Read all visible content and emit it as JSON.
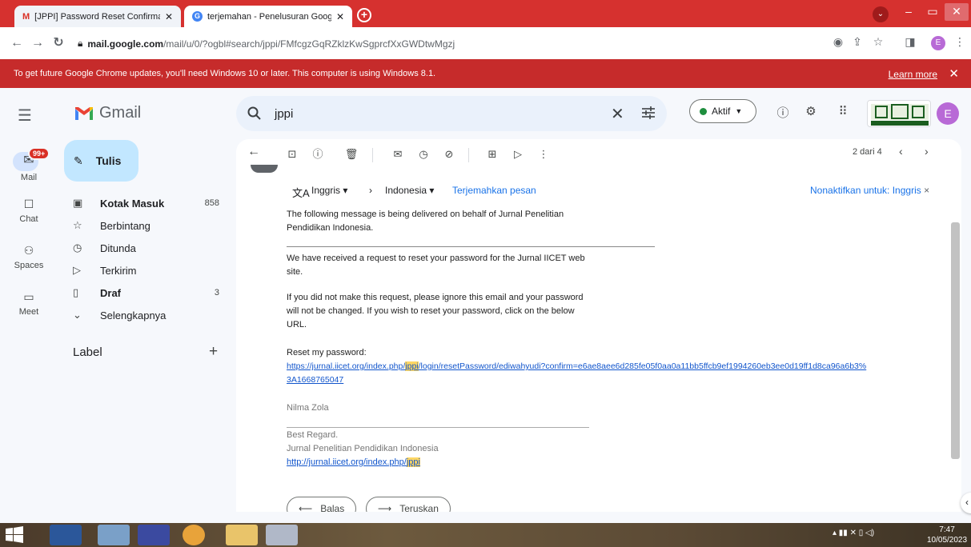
{
  "browser": {
    "tabs": [
      {
        "title": "[JPPI] Password Reset Confirmatio",
        "active": false
      },
      {
        "title": "terjemahan - Penelusuran Google",
        "active": true
      }
    ],
    "url_host": "mail.google.com",
    "url_path": "/mail/u/0/?ogbl#search/jppi/FMfcgzGqRZklzKwSgprcfXxGWDtwMgzj",
    "profile_initial": "E",
    "update_warning": "To get future Google Chrome updates, you'll need Windows 10 or later. This computer is using Windows 8.1.",
    "learn_more": "Learn more"
  },
  "gmail": {
    "app_name": "Gmail",
    "search_query": "jppi",
    "status": "Aktif",
    "avatar_initial": "E",
    "rail": [
      {
        "label": "Mail",
        "icon": "mail-icon",
        "badge": "99+"
      },
      {
        "label": "Chat",
        "icon": "chat-icon"
      },
      {
        "label": "Spaces",
        "icon": "spaces-icon"
      },
      {
        "label": "Meet",
        "icon": "meet-icon"
      }
    ],
    "compose_label": "Tulis",
    "nav": [
      {
        "label": "Kotak Masuk",
        "count": "858",
        "icon": "inbox-icon",
        "bold": true
      },
      {
        "label": "Berbintang",
        "count": "",
        "icon": "star-icon",
        "bold": false
      },
      {
        "label": "Ditunda",
        "count": "",
        "icon": "clock-icon",
        "bold": false
      },
      {
        "label": "Terkirim",
        "count": "",
        "icon": "send-icon",
        "bold": false
      },
      {
        "label": "Draf",
        "count": "3",
        "icon": "draft-icon",
        "bold": true
      },
      {
        "label": "Selengkapnya",
        "count": "",
        "icon": "chevron-down-icon",
        "bold": false
      }
    ],
    "labels_heading": "Label",
    "pager_text": "2 dari 4"
  },
  "translate": {
    "source_lang": "Inggris",
    "target_lang": "Indonesia",
    "translate_link": "Terjemahkan pesan",
    "disable_link": "Nonaktifkan untuk: Inggris"
  },
  "message": {
    "intro": "The following message is being delivered on behalf of Jurnal Penelitian Pendidikan Indonesia.",
    "intro_l1": "The following message is being delivered on behalf of Jurnal Penelitian",
    "intro_l2": "Pendidikan Indonesia.",
    "p1_l1": "We have received a request to reset your password for the Jurnal IICET web",
    "p1_l2": "site.",
    "p2_l1": "If you did not make this request, please ignore this email and your password",
    "p2_l2": "will not be changed. If you wish to reset your password, click on the below",
    "p2_l3": "URL.",
    "reset_label": "Reset my password:",
    "reset_url_a": "https://jurnal.iicet.org/index.php/",
    "reset_url_hl": "jppi",
    "reset_url_b": "/login/resetPassword/ediwahyudi?confirm=e6ae8aee6d285fe05f0aa0a11bb5ffcb9ef1994260eb3ee0d19ff1d8ca96a6b3%",
    "reset_url_c": "3A1668765047",
    "sender_name": "Nilma Zola",
    "sig_l1": "Best Regard.",
    "sig_l2": "Jurnal Penelitian Pendidikan Indonesia",
    "sig_url_a": "http://jurnal.iicet.org/index.php/",
    "sig_url_hl": "jppi",
    "reply_label": "Balas",
    "forward_label": "Teruskan"
  },
  "taskbar": {
    "time": "7:47",
    "date": "10/05/2023"
  }
}
